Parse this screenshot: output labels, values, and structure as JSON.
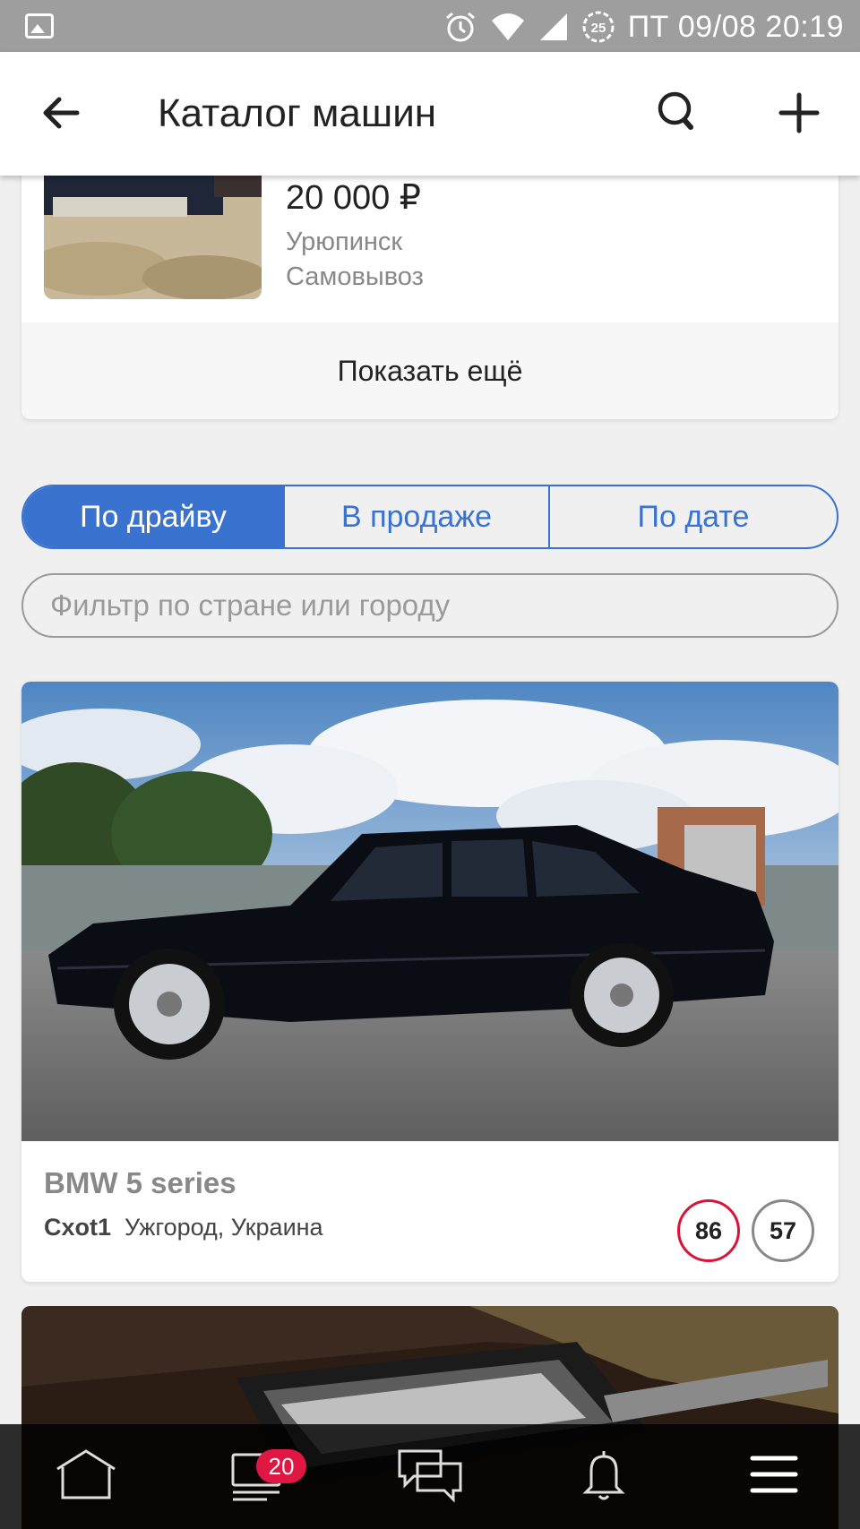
{
  "status_bar": {
    "time": "ПТ 09/08 20:19",
    "icons": [
      "gallery-icon",
      "alarm-icon",
      "wifi-icon",
      "signal-icon",
      "battery-saver-icon"
    ],
    "battery_badge": "25"
  },
  "app_bar": {
    "title": "Каталог машин",
    "icons": [
      "back-arrow-icon",
      "search-icon",
      "plus-icon"
    ]
  },
  "listing": {
    "price": "20 000 ₽",
    "city": "Урюпинск",
    "delivery": "Самовывоз",
    "show_more": "Показать ещё"
  },
  "sort_tabs": [
    {
      "label": "По драйву",
      "active": true
    },
    {
      "label": "В продаже",
      "active": false
    },
    {
      "label": "По дате",
      "active": false
    }
  ],
  "filter": {
    "placeholder": "Фильтр по стране или городу",
    "value": ""
  },
  "cars": [
    {
      "model": "BMW 5 series",
      "user": "Cxot1",
      "location": "Ужгород, Украина",
      "drive": "86",
      "followers": "57"
    }
  ],
  "bottom_nav": {
    "items": [
      "home-icon",
      "feed-icon",
      "chat-icon",
      "bell-icon",
      "menu-icon"
    ],
    "feed_badge": "20"
  },
  "colors": {
    "accent": "#3a72cf",
    "badge_red": "#d8143a",
    "status_bar": "#9e9e9e"
  }
}
